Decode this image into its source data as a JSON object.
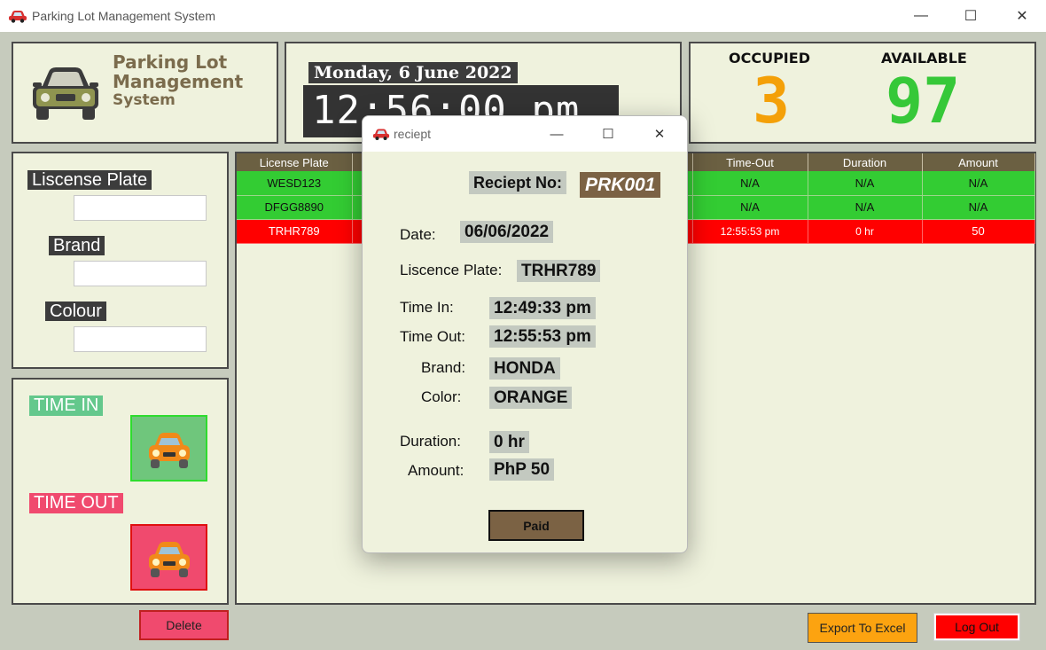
{
  "window": {
    "title": "Parking Lot Management System",
    "minimize": "—",
    "maximize": "☐",
    "close": "✕"
  },
  "brand": {
    "line1": "Parking Lot",
    "line2": "Management",
    "line3": "System",
    "icon": "car-icon",
    "color": "#7b6c4d"
  },
  "clock": {
    "date": "Monday, 6 June 2022",
    "time": "12:56:00 pm"
  },
  "stats": {
    "occupied_label": "OCCUPIED",
    "occupied_value": "3",
    "available_label": "AVAILABLE",
    "available_value": "97",
    "occupied_color": "#f4a008",
    "available_color": "#36c838"
  },
  "inputs": {
    "plate_label": "Liscense Plate",
    "plate_value": "",
    "brand_label": "Brand",
    "brand_value": "",
    "colour_label": "Colour",
    "colour_value": ""
  },
  "actions": {
    "time_in_label": "TIME IN",
    "time_out_label": "TIME OUT",
    "time_in_color": "#6fc67c",
    "time_out_color": "#f04a6e"
  },
  "table": {
    "headers": [
      "License Plate",
      "",
      "",
      "",
      "Time-Out",
      "Duration",
      "Amount"
    ],
    "rows": [
      {
        "plate": "WESD123",
        "time_out": "N/A",
        "duration": "N/A",
        "amount": "N/A",
        "status": "green"
      },
      {
        "plate": "DFGG8890",
        "time_out": "N/A",
        "duration": "N/A",
        "amount": "N/A",
        "status": "green"
      },
      {
        "plate": "TRHR789",
        "time_out": "12:55:53 pm",
        "duration": "0 hr",
        "amount": "50",
        "status": "red"
      }
    ]
  },
  "buttons": {
    "delete": "Delete",
    "export": "Export To Excel",
    "logout": "Log Out"
  },
  "receipt": {
    "title": "reciept",
    "no_label": "Reciept No:",
    "no_value": "PRK001",
    "date_label": "Date:",
    "date_value": "06/06/2022",
    "plate_label": "Liscence Plate:",
    "plate_value": "TRHR789",
    "time_in_label": "Time In:",
    "time_in_value": "12:49:33 pm",
    "time_out_label": "Time Out:",
    "time_out_value": "12:55:53 pm",
    "brand_label": "Brand:",
    "brand_value": "HONDA",
    "color_label": "Color:",
    "color_value": "ORANGE",
    "duration_label": "Duration:",
    "duration_value": "0 hr",
    "amount_label": "Amount:",
    "amount_value": "PhP 50",
    "paid_button": "Paid"
  }
}
